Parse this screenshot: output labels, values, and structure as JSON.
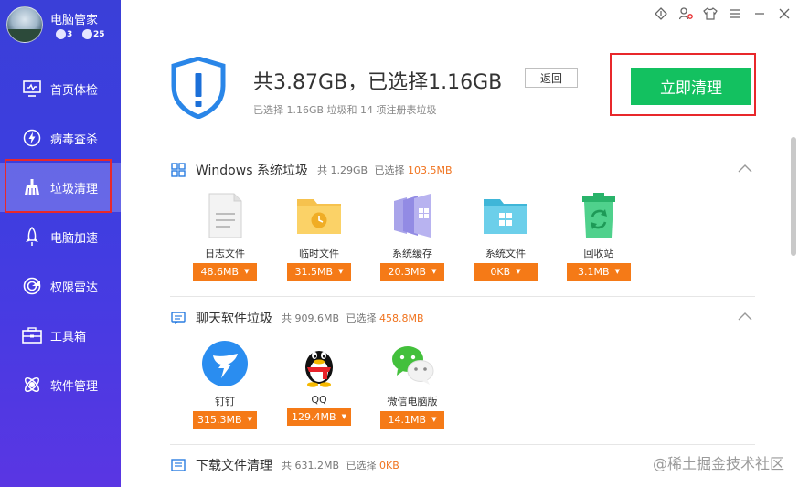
{
  "app": {
    "name": "电脑管家",
    "badge1": "3",
    "badge2": "25"
  },
  "nav": [
    {
      "label": "首页体检",
      "icon": "monitor-icon"
    },
    {
      "label": "病毒查杀",
      "icon": "bolt-icon"
    },
    {
      "label": "垃圾清理",
      "icon": "broom-icon",
      "active": true
    },
    {
      "label": "电脑加速",
      "icon": "rocket-icon"
    },
    {
      "label": "权限雷达",
      "icon": "radar-icon"
    },
    {
      "label": "工具箱",
      "icon": "toolbox-icon"
    },
    {
      "label": "软件管理",
      "icon": "software-icon"
    }
  ],
  "header": {
    "headline": "共3.87GB，已选择1.16GB",
    "back_label": "返回",
    "subline": "已选择 1.16GB 垃圾和 14 项注册表垃圾",
    "clean_label": "立即清理"
  },
  "sections": [
    {
      "name": "Windows 系统垃圾",
      "total": "共 1.29GB",
      "selected_prefix": "已选择",
      "selected": "103.5MB",
      "items": [
        {
          "label": "日志文件",
          "size": "48.6MB",
          "icon": "log-file-icon"
        },
        {
          "label": "临时文件",
          "size": "31.5MB",
          "icon": "temp-folder-icon"
        },
        {
          "label": "系统缓存",
          "size": "20.3MB",
          "icon": "system-cache-icon"
        },
        {
          "label": "系统文件",
          "size": "0KB",
          "icon": "system-folder-icon"
        },
        {
          "label": "回收站",
          "size": "3.1MB",
          "icon": "recycle-bin-icon"
        }
      ]
    },
    {
      "name": "聊天软件垃圾",
      "total": "共 909.6MB",
      "selected_prefix": "已选择",
      "selected": "458.8MB",
      "items": [
        {
          "label": "钉钉",
          "size": "315.3MB",
          "icon": "dingtalk-icon"
        },
        {
          "label": "QQ",
          "size": "129.4MB",
          "icon": "qq-icon"
        },
        {
          "label": "微信电脑版",
          "size": "14.1MB",
          "icon": "wechat-icon"
        }
      ]
    },
    {
      "name": "下载文件清理",
      "total": "共 631.2MB",
      "selected_prefix": "已选择",
      "selected": "0KB"
    }
  ],
  "watermark": "@稀土掘金技术社区",
  "colors": {
    "sidebar": "#3d3ee0",
    "accent_green": "#13c160",
    "orange": "#f57a17",
    "highlight_red": "#e8282b"
  }
}
